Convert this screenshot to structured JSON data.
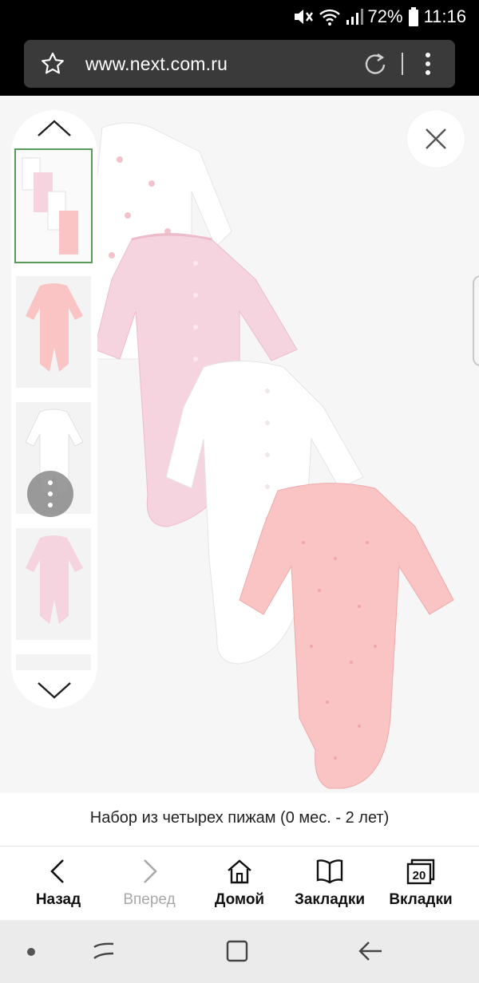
{
  "status": {
    "battery": "72%",
    "time": "11:16"
  },
  "browser": {
    "url": "www.next.com.ru"
  },
  "product": {
    "caption": "Набор из четырех пижам (0 мес. - 2 лет)"
  },
  "bottom_nav": {
    "back": "Назад",
    "forward": "Вперед",
    "home": "Домой",
    "bookmarks": "Закладки",
    "tabs": "Вкладки",
    "tabs_count": "20"
  },
  "colors": {
    "pink_light": "#f6d4df",
    "pink_coral": "#f9c4c3",
    "white_garment": "#ffffff",
    "thumb_active_border": "#5a9a5a"
  },
  "icons": [
    "mute-icon",
    "wifi-icon",
    "signal-icon",
    "battery-icon",
    "star-icon",
    "reload-icon",
    "more-icon",
    "close-icon",
    "chevron-up-icon",
    "chevron-down-icon",
    "back-icon",
    "forward-icon",
    "home-icon",
    "bookmarks-icon",
    "tabs-icon",
    "recent-apps-icon",
    "home-square-icon",
    "back-arrow-icon"
  ]
}
